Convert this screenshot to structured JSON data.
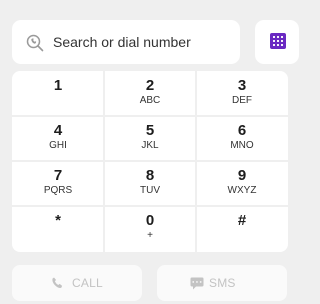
{
  "search": {
    "placeholder": "Search or dial number",
    "icon": "search-icon"
  },
  "keypad_toggle": {
    "icon": "keypad-icon",
    "color": "#6a29c2"
  },
  "keys": [
    {
      "digit": "1",
      "letters": ""
    },
    {
      "digit": "2",
      "letters": "ABC"
    },
    {
      "digit": "3",
      "letters": "DEF"
    },
    {
      "digit": "4",
      "letters": "GHI"
    },
    {
      "digit": "5",
      "letters": "JKL"
    },
    {
      "digit": "6",
      "letters": "MNO"
    },
    {
      "digit": "7",
      "letters": "PQRS"
    },
    {
      "digit": "8",
      "letters": "TUV"
    },
    {
      "digit": "9",
      "letters": "WXYZ"
    },
    {
      "digit": "*",
      "letters": ""
    },
    {
      "digit": "0",
      "letters": "+"
    },
    {
      "digit": "#",
      "letters": ""
    }
  ],
  "actions": {
    "call_label": "CALL",
    "call_icon": "phone-icon",
    "sms_label": "SMS",
    "sms_icon": "sms-icon",
    "disabled_color": "#c3c3c3"
  }
}
